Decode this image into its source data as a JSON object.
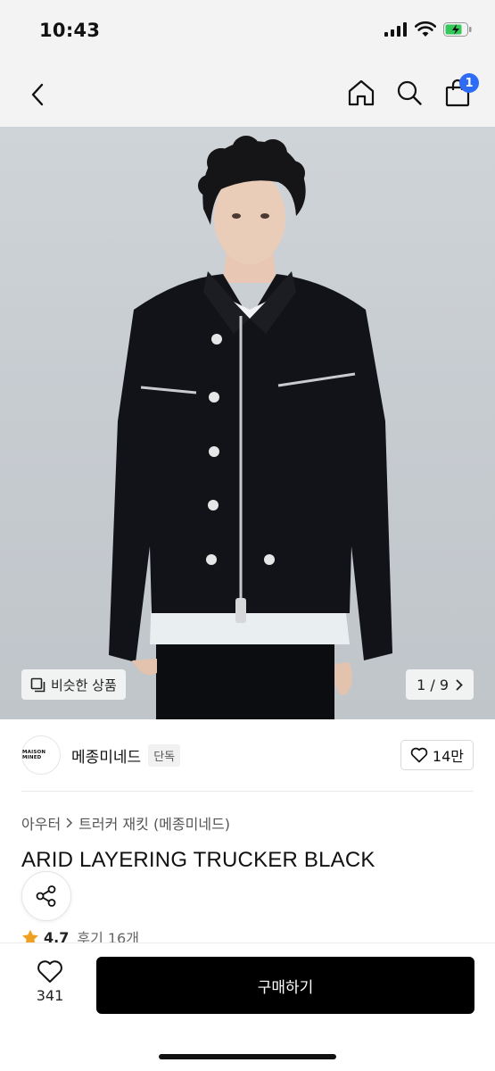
{
  "status_bar": {
    "time": "10:43"
  },
  "nav": {
    "cart_badge": "1"
  },
  "hero": {
    "similar_label": "비슷한 상품",
    "pager_label": "1 / 9"
  },
  "brand": {
    "logo_text": "MAISON MINED",
    "name": "메종미네드",
    "tag": "단독",
    "like_count": "14만"
  },
  "breadcrumb": {
    "category": "아우터",
    "subcategory": "트러커 재킷 (메종미네드)"
  },
  "product": {
    "title": "ARID LAYERING TRUCKER BLACK",
    "rating": "4.7",
    "reviews": "후기 16개"
  },
  "bottom_bar": {
    "wish_count": "341",
    "buy_label": "구매하기"
  },
  "colors": {
    "accent_badge": "#2f6cf6",
    "star": "#f0a020",
    "buy_button": "#000000"
  }
}
